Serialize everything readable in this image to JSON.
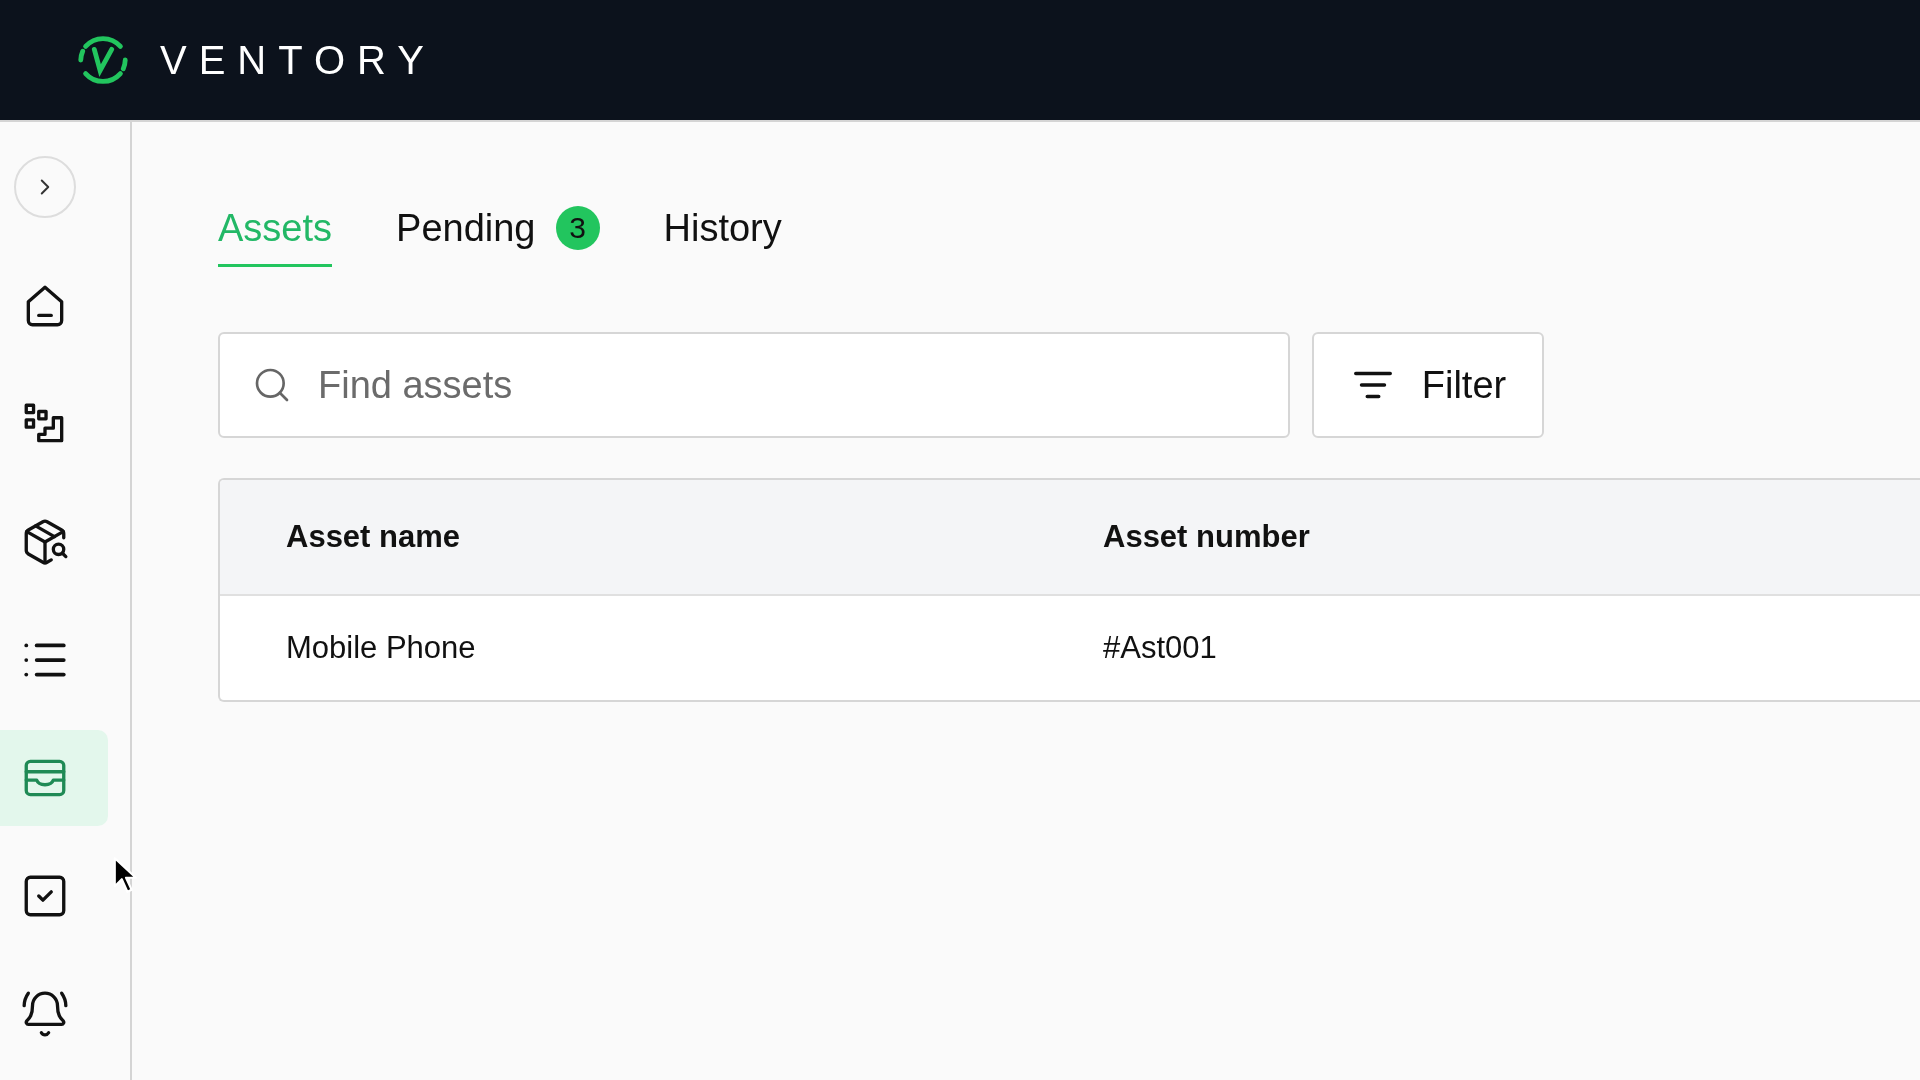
{
  "header": {
    "logo_text": "VENTORY"
  },
  "sidebar": {
    "items": [
      {
        "selected": false
      },
      {
        "selected": false
      },
      {
        "selected": false
      },
      {
        "selected": false
      },
      {
        "selected": true
      },
      {
        "selected": false
      },
      {
        "selected": false
      }
    ]
  },
  "tabs": [
    {
      "label": "Assets",
      "selected": true
    },
    {
      "label": "Pending",
      "selected": false,
      "badge": "3"
    },
    {
      "label": "History",
      "selected": false
    }
  ],
  "search": {
    "placeholder": "Find assets"
  },
  "filter_button": {
    "label": "Filter"
  },
  "table": {
    "columns": [
      "Asset name",
      "Asset number"
    ],
    "rows": [
      [
        "Mobile Phone",
        "#Ast001"
      ]
    ]
  }
}
